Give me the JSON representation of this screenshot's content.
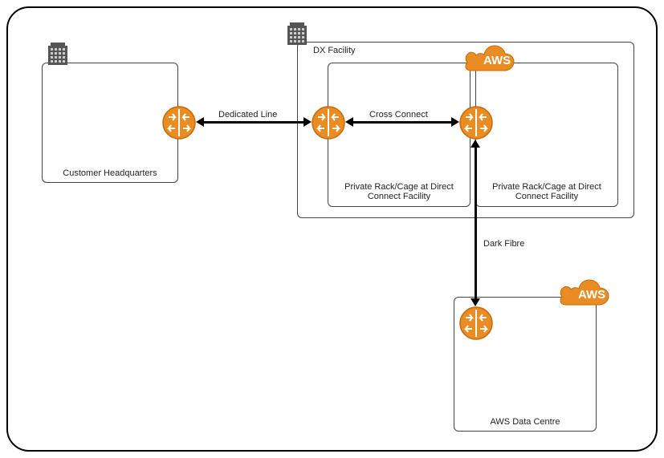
{
  "diagram": {
    "boxes": {
      "customer_hq": {
        "label": "Customer Headquarters"
      },
      "dx_facility": {
        "label": "DX Facility"
      },
      "private_rack_left": {
        "label": "Private Rack/Cage at Direct Connect Facility"
      },
      "private_rack_right": {
        "label": "Private Rack/Cage at Direct Connect Facility"
      },
      "aws_dc": {
        "label": "AWS Data Centre"
      }
    },
    "connections": {
      "dedicated_line": {
        "label": "Dedicated Line"
      },
      "cross_connect": {
        "label": "Cross Connect"
      },
      "dark_fibre": {
        "label": "Dark Fibre"
      }
    },
    "icons": {
      "aws_label": "AWS"
    }
  }
}
